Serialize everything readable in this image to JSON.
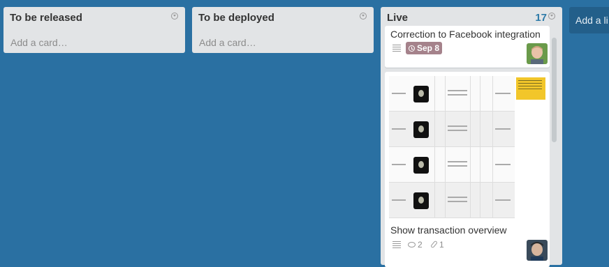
{
  "lists": [
    {
      "title": "To be released",
      "add_card": "Add a card…"
    },
    {
      "title": "To be deployed",
      "add_card": "Add a card…"
    },
    {
      "title": "Live",
      "count": "17",
      "cards": [
        {
          "title": "Correction to Facebook integration",
          "due": "Sep 8",
          "icons": [
            "description-icon",
            "clock-icon"
          ]
        },
        {
          "title": "Show transaction overview",
          "comments": "2",
          "attachments": "1",
          "icons": [
            "description-icon",
            "comment-icon",
            "attachment-icon"
          ]
        }
      ]
    }
  ],
  "add_list": "Add a li",
  "colors": {
    "board": "#2a70a2",
    "list": "#e2e4e6",
    "due_badge": "#a5828b",
    "count": "#2d7aa8",
    "note": "#f2c62a"
  }
}
